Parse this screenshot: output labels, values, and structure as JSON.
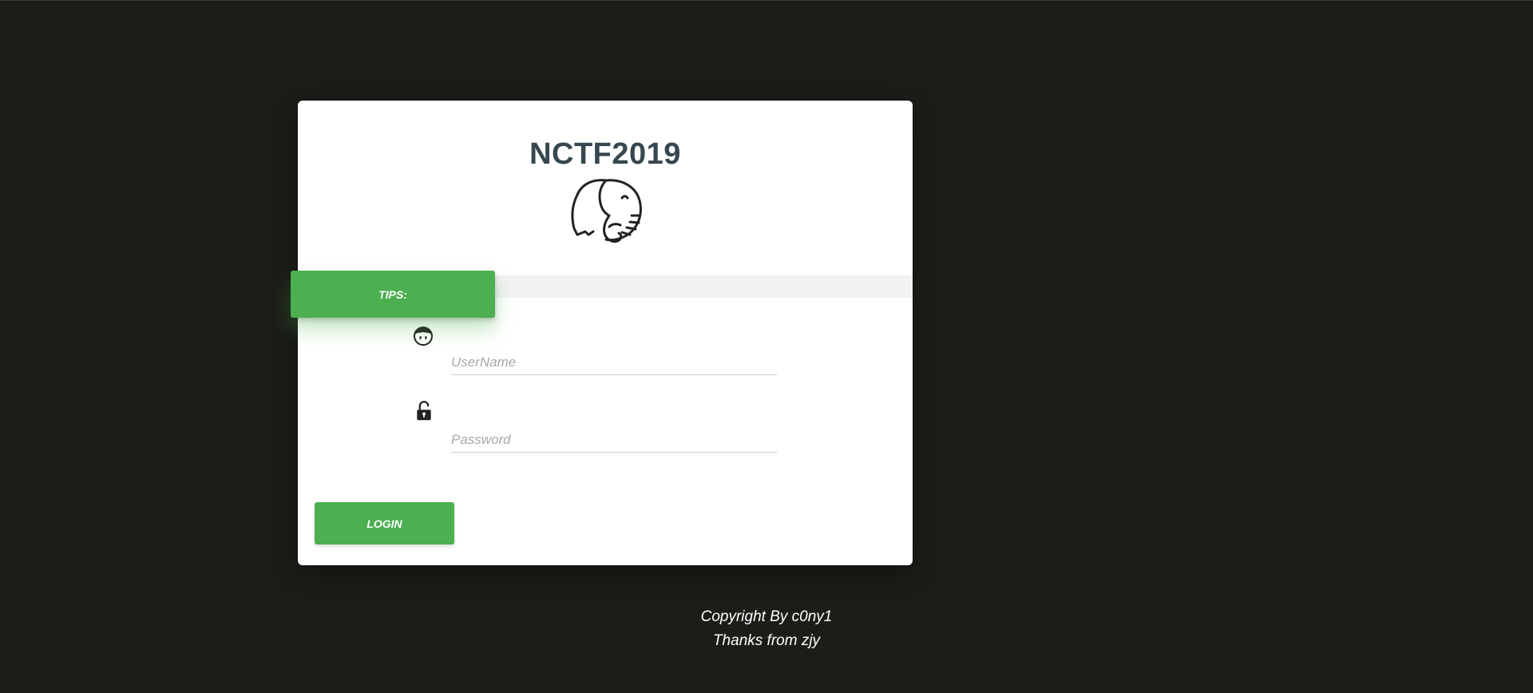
{
  "login_card": {
    "title": "NCTF2019",
    "tips_label": "TIPS:",
    "username_placeholder": "UserName",
    "password_placeholder": "Password",
    "login_label": "LOGIN",
    "logo_icon": "elephant-icon",
    "username_icon": "face-icon",
    "password_icon": "unlocked-padlock-icon"
  },
  "footer": {
    "copyright": "Copyright By c0ny1",
    "thanks": "Thanks from zjy"
  },
  "colors": {
    "background": "#1c1d19",
    "accent": "#4caf50",
    "title": "#37474f",
    "card": "#ffffff"
  }
}
